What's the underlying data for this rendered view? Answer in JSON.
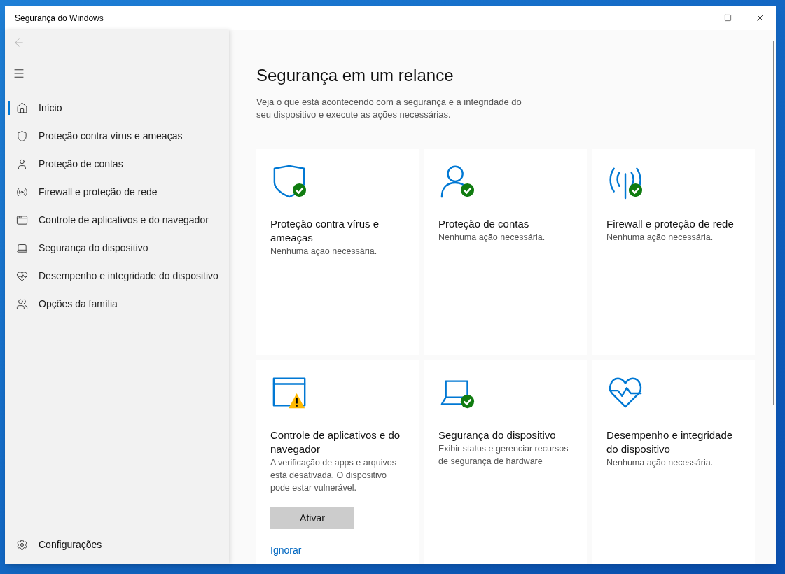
{
  "window": {
    "title": "Segurança do Windows"
  },
  "sidebar": {
    "items": [
      {
        "label": "Início",
        "selected": true
      },
      {
        "label": "Proteção contra vírus e ameaças",
        "selected": false
      },
      {
        "label": "Proteção de contas",
        "selected": false
      },
      {
        "label": "Firewall e proteção de rede",
        "selected": false
      },
      {
        "label": "Controle de aplicativos e do navegador",
        "selected": false
      },
      {
        "label": "Segurança do dispositivo",
        "selected": false
      },
      {
        "label": "Desempenho e integridade do dispositivo",
        "selected": false
      },
      {
        "label": "Opções da família",
        "selected": false
      }
    ],
    "settings": {
      "label": "Configurações"
    }
  },
  "main": {
    "title": "Segurança em um relance",
    "description": "Veja o que está acontecendo com a segurança e a integridade do seu dispositivo e execute as ações necessárias.",
    "cards": [
      {
        "kind": "ok",
        "title": "Proteção contra vírus e ameaças",
        "description": "Nenhuma ação necessária."
      },
      {
        "kind": "ok",
        "title": "Proteção de contas",
        "description": "Nenhuma ação necessária."
      },
      {
        "kind": "ok",
        "title": "Firewall e proteção de rede",
        "description": "Nenhuma ação necessária."
      },
      {
        "kind": "warning",
        "title": "Controle de aplicativos e do navegador",
        "description": "A verificação de apps e arquivos está desativada. O dispositivo pode estar vulnerável.",
        "button": "Ativar",
        "link": "Ignorar"
      },
      {
        "kind": "ok",
        "title": "Segurança do dispositivo",
        "description": "Exibir status e gerenciar recursos de segurança de hardware"
      },
      {
        "kind": "plain",
        "title": "Desempenho e integridade do dispositivo",
        "description": "Nenhuma ação necessária."
      }
    ]
  }
}
